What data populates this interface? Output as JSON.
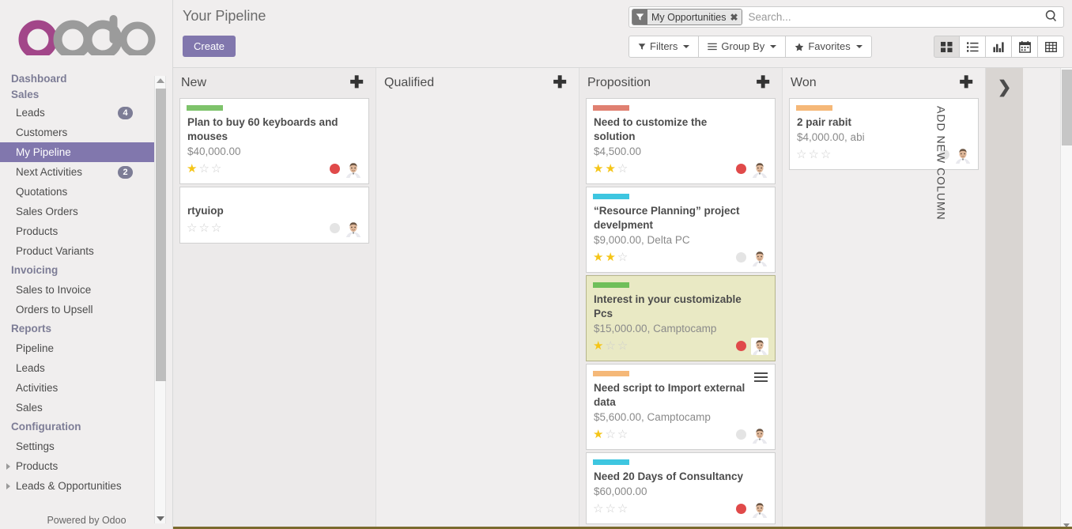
{
  "brand": {
    "logo_text": "odoo",
    "accent_color": "#a24689",
    "grey_color": "#9b9b9b",
    "powered_by": "Powered by Odoo"
  },
  "sidebar": {
    "groups": [
      {
        "heading": "Dashboard",
        "heading2": "Sales",
        "items": [
          {
            "label": "Leads",
            "badge": "4",
            "active": false
          },
          {
            "label": "Customers",
            "badge": "",
            "active": false
          },
          {
            "label": "My Pipeline",
            "badge": "",
            "active": true
          },
          {
            "label": "Next Activities",
            "badge": "2",
            "active": false
          },
          {
            "label": "Quotations",
            "badge": "",
            "active": false
          },
          {
            "label": "Sales Orders",
            "badge": "",
            "active": false
          },
          {
            "label": "Products",
            "badge": "",
            "active": false
          },
          {
            "label": "Product Variants",
            "badge": "",
            "active": false
          }
        ]
      },
      {
        "heading": "Invoicing",
        "items": [
          {
            "label": "Sales to Invoice",
            "badge": "",
            "active": false
          },
          {
            "label": "Orders to Upsell",
            "badge": "",
            "active": false
          }
        ]
      },
      {
        "heading": "Reports",
        "items": [
          {
            "label": "Pipeline",
            "badge": "",
            "active": false
          },
          {
            "label": "Leads",
            "badge": "",
            "active": false
          },
          {
            "label": "Activities",
            "badge": "",
            "active": false
          },
          {
            "label": "Sales",
            "badge": "",
            "active": false
          }
        ]
      },
      {
        "heading": "Configuration",
        "items": [
          {
            "label": "Settings",
            "badge": "",
            "active": false,
            "expandable": false
          },
          {
            "label": "Products",
            "badge": "",
            "active": false,
            "expandable": true
          },
          {
            "label": "Leads & Opportunities",
            "badge": "",
            "active": false,
            "expandable": true
          }
        ]
      }
    ]
  },
  "control_panel": {
    "title": "Your Pipeline",
    "create_label": "Create",
    "search": {
      "facet_label": "My Opportunities",
      "facet_remove": "✖",
      "placeholder": "Search..."
    },
    "buttons": [
      {
        "label": "Filters",
        "icon": "filter-icon"
      },
      {
        "label": "Group By",
        "icon": "list-icon"
      },
      {
        "label": "Favorites",
        "icon": "star-icon"
      }
    ],
    "views": [
      {
        "name": "kanban",
        "active": true
      },
      {
        "name": "list",
        "active": false
      },
      {
        "name": "graph",
        "active": false
      },
      {
        "name": "calendar",
        "active": false
      },
      {
        "name": "pivot",
        "active": false
      }
    ]
  },
  "kanban": {
    "add_column_label": "ADD NEW COLUMN",
    "columns": [
      {
        "title": "New",
        "shaded": true,
        "cards": [
          {
            "bar_color": "#7ec36b",
            "title": "Plan to buy 60 keyboards and mouses",
            "subtitle": "$40,000.00",
            "stars": 1,
            "dot": "red",
            "highlight": false,
            "burger": false
          },
          {
            "bar_color": "",
            "title": "rtyuiop",
            "subtitle": "",
            "stars": 0,
            "dot": "grey",
            "highlight": false,
            "burger": false
          }
        ]
      },
      {
        "title": "Qualified",
        "shaded": false,
        "cards": []
      },
      {
        "title": "Proposition",
        "shaded": true,
        "cards": [
          {
            "bar_color": "#e08071",
            "title": "Need to customize the solution",
            "subtitle": "$4,500.00",
            "stars": 2,
            "dot": "red",
            "highlight": false,
            "burger": false
          },
          {
            "bar_color": "#3ec6e0",
            "title": "“Resource Planning” project develpment",
            "subtitle": "$9,000.00, Delta PC",
            "stars": 2,
            "dot": "grey",
            "highlight": false,
            "burger": false
          },
          {
            "bar_color": "#6fbf5a",
            "title": "Interest in your customizable Pcs",
            "subtitle": "$15,000.00, Camptocamp",
            "stars": 1,
            "dot": "red",
            "highlight": true,
            "burger": false
          },
          {
            "bar_color": "#f5b878",
            "title": "Need script to Import external data",
            "subtitle": "$5,600.00, Camptocamp",
            "stars": 1,
            "dot": "grey",
            "highlight": false,
            "burger": true
          },
          {
            "bar_color": "#3ec6e0",
            "title": "Need 20 Days of Consultancy",
            "subtitle": "$60,000.00",
            "stars": 0,
            "dot": "red",
            "highlight": false,
            "burger": false
          }
        ]
      },
      {
        "title": "Won",
        "shaded": false,
        "cards": [
          {
            "bar_color": "#f5b878",
            "title": "2 pair rabit",
            "subtitle": "$4,000.00, abi",
            "stars": 0,
            "dot": "grey",
            "highlight": false,
            "burger": false
          }
        ]
      }
    ]
  }
}
